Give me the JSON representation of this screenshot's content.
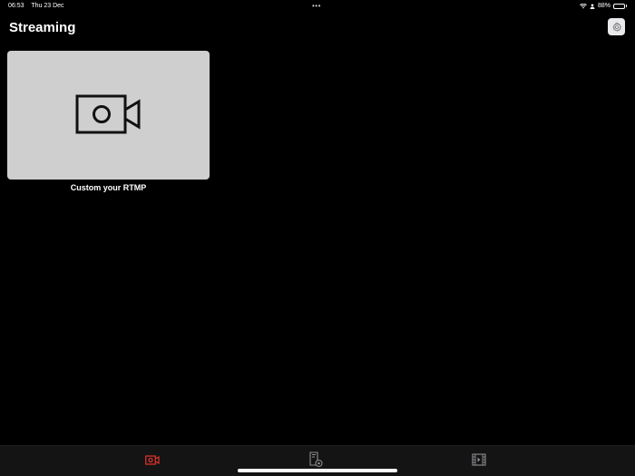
{
  "status_bar": {
    "time": "06:53",
    "date": "Thu 23 Dec",
    "dots": "•••",
    "battery_percent": "88%",
    "battery_level": 0.88,
    "icons": [
      "wifi-icon",
      "location-icon",
      "battery-icon"
    ]
  },
  "header": {
    "title": "Streaming",
    "settings_icon": "gear-icon"
  },
  "cards": [
    {
      "label": "Custom your RTMP",
      "icon": "video-camera-icon"
    }
  ],
  "tab_bar": {
    "tabs": [
      {
        "icon": "video-camera-icon",
        "active": true
      },
      {
        "icon": "document-record-icon",
        "active": false
      },
      {
        "icon": "film-icon",
        "active": false
      }
    ],
    "active_color": "#e5322d",
    "inactive_color": "#8e8e93"
  },
  "colors": {
    "background": "#000000",
    "card_background": "#cfcfcf"
  }
}
